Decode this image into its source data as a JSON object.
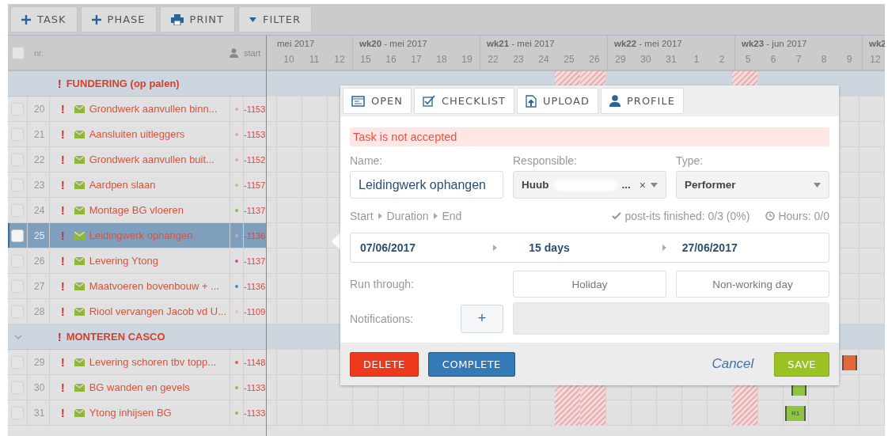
{
  "toolbar": [
    {
      "label": "TASK"
    },
    {
      "label": "PHASE"
    },
    {
      "label": "PRINT"
    },
    {
      "label": "FILTER"
    }
  ],
  "header": {
    "checked": false,
    "nr": "nr.",
    "start": "start"
  },
  "timeline": {
    "weeks": [
      {
        "label": "mei 2017",
        "days": [
          {
            "d": "10",
            "holiday": false
          },
          {
            "d": "11",
            "holiday": false
          },
          {
            "d": "12",
            "holiday": false
          }
        ]
      },
      {
        "label": "**wk20** - mei 2017",
        "days": [
          {
            "d": "15",
            "holiday": false
          },
          {
            "d": "16",
            "holiday": false
          },
          {
            "d": "17",
            "holiday": false
          },
          {
            "d": "18",
            "holiday": false
          },
          {
            "d": "19",
            "holiday": false
          }
        ]
      },
      {
        "label": "**wk21** - mei 2017",
        "days": [
          {
            "d": "22",
            "holiday": false
          },
          {
            "d": "23",
            "holiday": false
          },
          {
            "d": "24",
            "holiday": false
          },
          {
            "d": "25",
            "holiday": true
          },
          {
            "d": "26",
            "holiday": true
          }
        ]
      },
      {
        "label": "**wk22** - mei 2017",
        "days": [
          {
            "d": "29",
            "holiday": false
          },
          {
            "d": "30",
            "holiday": false
          },
          {
            "d": "31",
            "holiday": false
          },
          {
            "d": "1",
            "holiday": false
          },
          {
            "d": "2",
            "holiday": false
          }
        ]
      },
      {
        "label": "**wk23** - jun 2017",
        "days": [
          {
            "d": "5",
            "holiday": true
          },
          {
            "d": "6",
            "holiday": false
          },
          {
            "d": "7",
            "holiday": false
          },
          {
            "d": "8",
            "holiday": false
          },
          {
            "d": "9",
            "holiday": false
          }
        ]
      },
      {
        "label": "**wk2**",
        "days": [
          {
            "d": "12",
            "holiday": false
          }
        ]
      }
    ]
  },
  "groups": [
    {
      "flag": "!",
      "title": "FUNDERING (op palen)",
      "chevron": false,
      "tasks": [
        {
          "nr": "20",
          "flag": "!",
          "name": "Grondwerk aanvullen binn...",
          "color": "#f2a3a3",
          "start": "-1153",
          "checked": false,
          "selected": false
        },
        {
          "nr": "21",
          "flag": "!",
          "name": "Aansluiten uitleggers",
          "color": "#f2a3a3",
          "start": "-1153",
          "checked": false,
          "selected": false
        },
        {
          "nr": "22",
          "flag": "!",
          "name": "Grondwerk aanvullen buit...",
          "color": "#f2a3a3",
          "start": "-1152",
          "checked": false,
          "selected": false
        },
        {
          "nr": "23",
          "flag": "!",
          "name": "Aardpen slaan",
          "color": "#a5d67a",
          "start": "-1157",
          "checked": false,
          "selected": false
        },
        {
          "nr": "24",
          "flag": "!",
          "name": "Montage BG vloeren",
          "color": "#7cc04b",
          "start": "-1137",
          "checked": false,
          "selected": false
        },
        {
          "nr": "25",
          "flag": "!",
          "name": "Leidingwerk ophangen",
          "color": "#c9a0d0",
          "start": "-1136",
          "checked": false,
          "selected": true
        },
        {
          "nr": "26",
          "flag": "!",
          "name": "Levering Ytong",
          "color": "#d04fb0",
          "start": "-1137",
          "checked": false,
          "selected": false
        },
        {
          "nr": "27",
          "flag": "!",
          "name": "Maatvoeren bovenbouw + ...",
          "color": "#3b8fd9",
          "start": "-1136",
          "checked": false,
          "selected": false
        },
        {
          "nr": "28",
          "flag": "!",
          "name": "Riool vervangen Jacob vd U...",
          "color": "#f0b4dc",
          "start": "-1109",
          "checked": false,
          "selected": false
        }
      ]
    },
    {
      "flag": "!",
      "title": "MONTEREN CASCO",
      "chevron": true,
      "tasks": [
        {
          "nr": "29",
          "flag": "!",
          "name": "Levering schoren tbv topp...",
          "color": "#e8603c",
          "start": "-1148",
          "checked": false,
          "selected": false,
          "bar": {
            "color": "#e0683c"
          }
        },
        {
          "nr": "30",
          "flag": "!",
          "name": "BG wanden en gevels",
          "color": "#8bc34a",
          "start": "-1133",
          "checked": false,
          "selected": false,
          "bar": {
            "color": "#8cc63f"
          }
        },
        {
          "nr": "31",
          "flag": "!",
          "name": "Ytong inhijsen BG",
          "color": "#8bc34a",
          "start": "-1133",
          "checked": false,
          "selected": false,
          "bar": {
            "color": "#8cc63f",
            "label": "R1"
          }
        }
      ]
    }
  ],
  "task_dialog": {
    "tabs": [
      {
        "label": "OPEN"
      },
      {
        "label": "CHECKLIST"
      },
      {
        "label": "UPLOAD"
      },
      {
        "label": "PROFILE"
      }
    ],
    "alert": "Task is not accepted",
    "name_label": "Name:",
    "name_value": "Leidingwerk ophangen",
    "responsible_label": "Responsible:",
    "responsible_value": "Huub",
    "responsible_tail": "...",
    "clear": "×",
    "type_label": "Type:",
    "type_value": "Performer",
    "flow": [
      "Start",
      "Duration",
      "End"
    ],
    "postits": "post-its finished: 0/3 (0%)",
    "hours": "Hours: 0/0",
    "start_date": "07/06/2017",
    "duration": "15 days",
    "end_date": "27/06/2017",
    "run_through_label": "Run through:",
    "run_options": [
      {
        "label": "Holiday",
        "selected": false
      },
      {
        "label": "Non-working day",
        "selected": false
      }
    ],
    "notifications_label": "Notifications:",
    "add": "+",
    "actions": {
      "delete": "DELETE",
      "complete": "COMPLETE",
      "cancel": "Cancel",
      "save": "SAVE"
    }
  }
}
